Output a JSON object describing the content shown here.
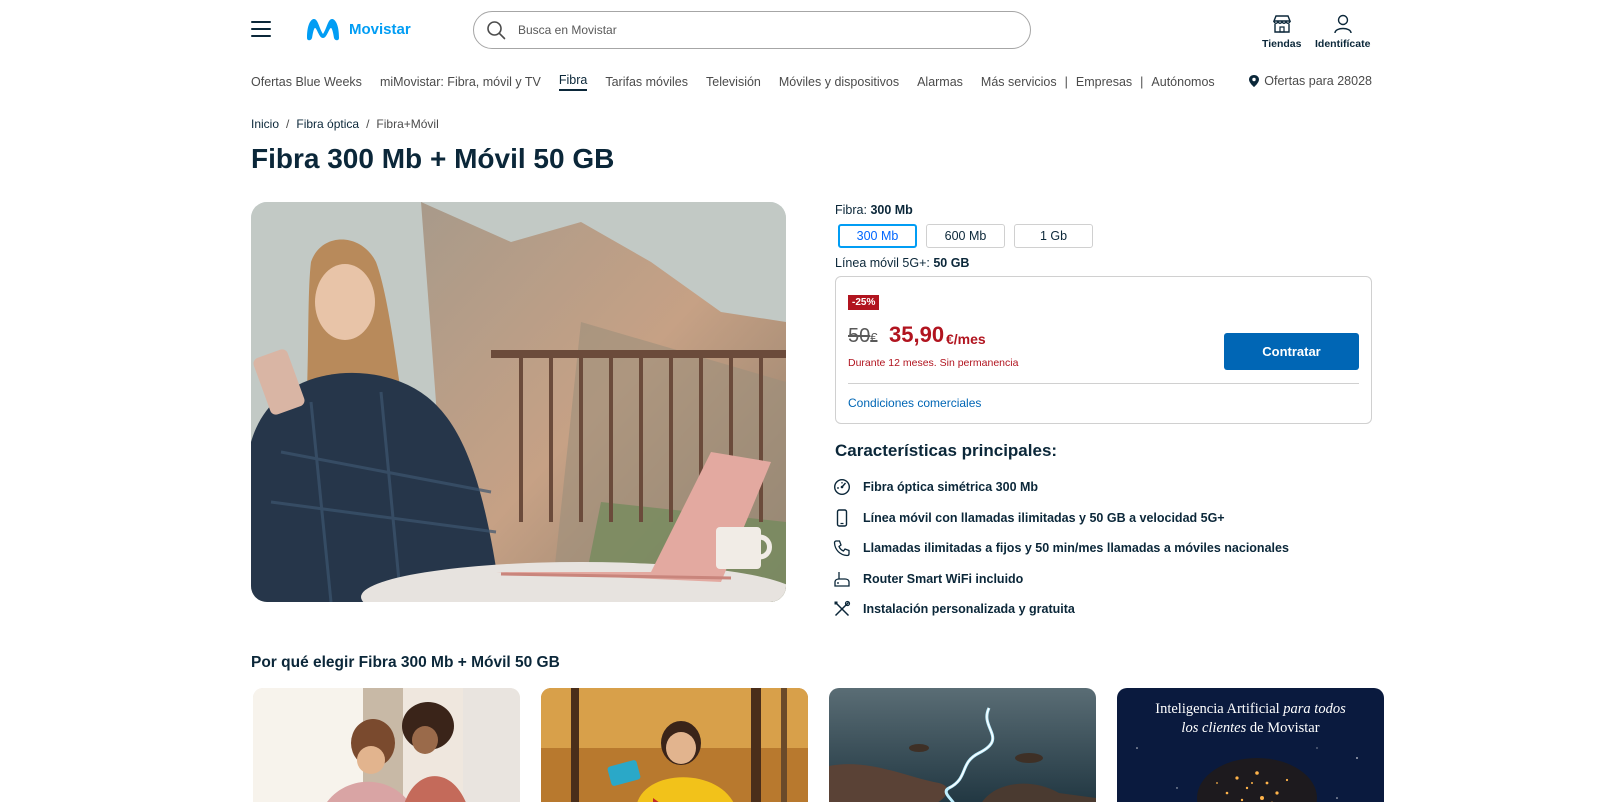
{
  "header": {
    "logo_text": "Movistar",
    "search_placeholder": "Busca en Movistar",
    "stores_label": "Tiendas",
    "login_label": "Identifícate",
    "brand_color": "#019df4"
  },
  "nav": {
    "items": [
      {
        "label": "Ofertas Blue Weeks"
      },
      {
        "label": "miMovistar: Fibra, móvil y TV"
      },
      {
        "label": "Fibra",
        "active": true
      },
      {
        "label": "Tarifas móviles"
      },
      {
        "label": "Televisión"
      },
      {
        "label": "Móviles y dispositivos"
      },
      {
        "label": "Alarmas"
      },
      {
        "label": "Más servicios"
      },
      {
        "label": "Empresas"
      },
      {
        "label": "Autónomos"
      }
    ],
    "location_label": "Ofertas para 28028"
  },
  "breadcrumb": {
    "items": [
      "Inicio",
      "Fibra óptica",
      "Fibra+Móvil"
    ]
  },
  "page_title": "Fibra 300 Mb + Móvil 50 GB",
  "options": {
    "fiber_label": "Fibra:",
    "fiber_value": "300 Mb",
    "fiber_choices": [
      "300 Mb",
      "600 Mb",
      "1 Gb"
    ],
    "selected_index": 0,
    "mobile_label": "Línea móvil 5G+:",
    "mobile_value": "50 GB"
  },
  "price": {
    "discount": "-25%",
    "old_price": "50",
    "old_currency": "€",
    "new_price": "35,90",
    "unit": "€/mes",
    "note": "Durante 12 meses. Sin permanencia",
    "cta": "Contratar",
    "conditions": "Condiciones comerciales",
    "accent_color": "#b1141f"
  },
  "features": {
    "title": "Características principales:",
    "items": [
      {
        "icon": "speed-icon",
        "text": "Fibra óptica simétrica 300 Mb"
      },
      {
        "icon": "mobile-icon",
        "text": "Línea móvil con llamadas ilimitadas y 50 GB a velocidad 5G+"
      },
      {
        "icon": "phone-icon",
        "text": "Llamadas ilimitadas a fijos y 50 min/mes llamadas a móviles nacionales"
      },
      {
        "icon": "router-icon",
        "text": "Router Smart WiFi incluido"
      },
      {
        "icon": "tools-icon",
        "text": "Instalación personalizada y gratuita"
      }
    ]
  },
  "why": {
    "title": "Por qué elegir Fibra 300 Mb + Móvil 50 GB",
    "ai_card": {
      "line1": "Inteligencia Artificial",
      "line1_italic": "para todos",
      "line2_italic": "los clientes",
      "line2": "de Movistar"
    }
  }
}
